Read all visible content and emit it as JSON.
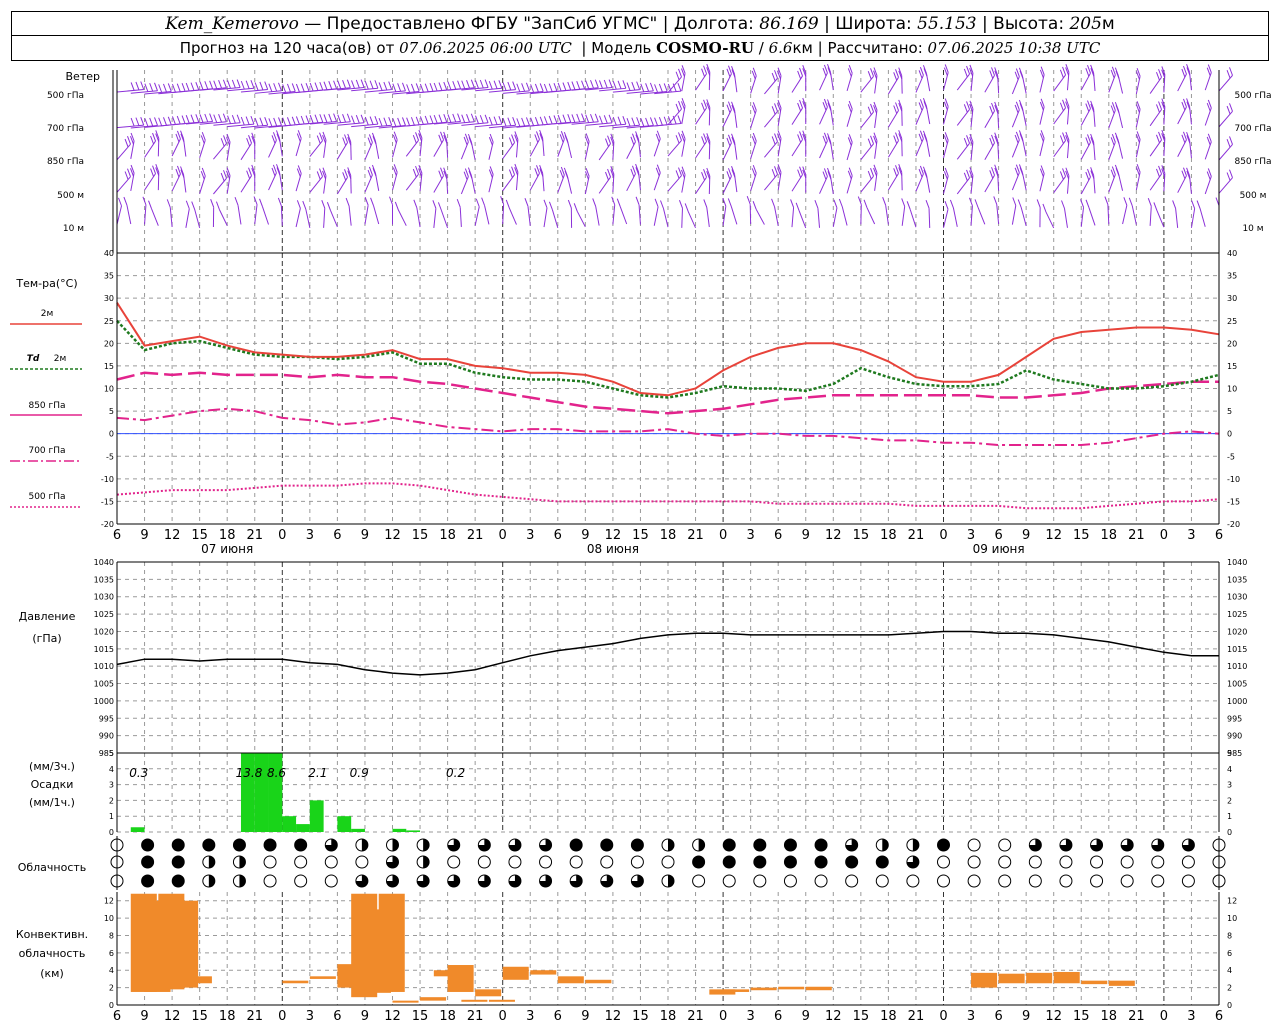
{
  "header": {
    "station": "Kem_Kemerovo",
    "provider": " — Предоставлено ФГБУ \"ЗапСиб УГМС\" | ",
    "lon_label": "Долгота: ",
    "lon_value": "86.169",
    "lat_label": " | Широта: ",
    "lat_value": "55.153",
    "alt_label": " | Высота: ",
    "alt_value": "205",
    "alt_unit": "м",
    "forecast_label": "Прогноз на 120 часа(ов) от ",
    "forecast_date": "07.06.2025 06:00 UTC",
    "model_label": "  | Модель ",
    "model_value": "COSMO-RU",
    "model_sep": " / ",
    "res_value": "6.6",
    "res_unit": "км",
    "calc_label": " | Рассчитано: ",
    "calc_date": "07.06.2025 10:38 UTC"
  },
  "colors": {
    "wind": "#8b30d8",
    "t2m": "#e8433a",
    "td2m": "#1f7a1f",
    "t850": "#e2238c",
    "t700": "#e2238c",
    "t500": "#e2238c",
    "zero": "#3050ff",
    "precip": "#19d419",
    "convective": "#f08a2a",
    "grid": "#9a9a9a"
  },
  "labels": {
    "wind": "Ветер",
    "wind_levels": [
      "500 гПа",
      "700 гПа",
      "850 гПа",
      "500 м",
      "10 м"
    ],
    "temp": "Тем-ра(°C)",
    "t2m": "2м",
    "td": "Td",
    "td_level": "2м",
    "t850": "850 гПа",
    "t700": "700 гПа",
    "t500": "500 гПа",
    "pressure": "Давление",
    "pressure_unit": "(гПа)",
    "precip_unit3": "(мм/3ч.)",
    "precip": "Осадки",
    "precip_unit1": "(мм/1ч.)",
    "cloud": "Облачность",
    "conv1": "Конвективн.",
    "conv2": "облачность",
    "conv3": "(км)"
  },
  "chart_data": {
    "type": "line",
    "x_hours": [
      0,
      3,
      6,
      9,
      12,
      15,
      18,
      21,
      24,
      27,
      30,
      33,
      36,
      39,
      42,
      45,
      48,
      51,
      54,
      57,
      60,
      63,
      66,
      69,
      72,
      75,
      78,
      81,
      84,
      87,
      90,
      93,
      96,
      99,
      102,
      105,
      108,
      111,
      114,
      117,
      120
    ],
    "x_tick_labels": [
      "6",
      "9",
      "12",
      "15",
      "18",
      "21",
      "0",
      "3",
      "6",
      "9",
      "12",
      "15",
      "18",
      "21",
      "0",
      "3",
      "6",
      "9",
      "12",
      "15",
      "18",
      "21",
      "0",
      "3",
      "6",
      "9",
      "12",
      "15",
      "18",
      "21",
      "0",
      "3",
      "6",
      "9",
      "12",
      "15",
      "18",
      "21",
      "0",
      "3",
      "6",
      "9",
      "12"
    ],
    "day_labels": [
      "07 июня",
      "08 июня",
      "09 июня"
    ],
    "temperature": {
      "ylim": [
        -20,
        40
      ],
      "ticks": [
        -20,
        -15,
        -10,
        -5,
        0,
        5,
        10,
        15,
        20,
        25,
        30,
        35,
        40
      ],
      "t2m": [
        29,
        19.5,
        20.5,
        21.5,
        19.5,
        18,
        17.5,
        17,
        17,
        17.5,
        18.5,
        16.5,
        16.5,
        15,
        14.5,
        13.5,
        13.5,
        13,
        11.5,
        9,
        8.5,
        10,
        14,
        17,
        19,
        20,
        20,
        18.5,
        16,
        12.5,
        11.5,
        11.5,
        13,
        17,
        21,
        22.5,
        23,
        23.5,
        23.5,
        23,
        22
      ],
      "td2m": [
        25,
        18.5,
        20,
        20.5,
        19,
        17.5,
        17,
        17,
        16.5,
        17,
        18,
        15.5,
        15.5,
        13.5,
        12.5,
        12,
        12,
        11.5,
        10,
        8.5,
        8,
        9,
        10.5,
        10,
        10,
        9.5,
        11,
        14.5,
        12.5,
        11,
        10.5,
        10.5,
        11,
        14,
        12,
        11,
        10,
        10,
        10.5,
        11.5,
        13
      ],
      "t850": [
        12,
        13.5,
        13,
        13.5,
        13,
        13,
        13,
        12.5,
        13,
        12.5,
        12.5,
        11.5,
        11,
        10,
        9,
        8,
        7,
        6,
        5.5,
        5,
        4.5,
        5,
        5.5,
        6.5,
        7.5,
        8,
        8.5,
        8.5,
        8.5,
        8.5,
        8.5,
        8.5,
        8,
        8,
        8.5,
        9,
        10,
        10.5,
        11,
        11.5,
        11.5
      ],
      "t700": [
        3.5,
        3,
        4,
        5,
        5.5,
        5,
        3.5,
        3,
        2,
        2.5,
        3.5,
        2.5,
        1.5,
        1,
        0.5,
        1,
        1,
        0.5,
        0.5,
        0.5,
        1,
        0,
        -0.5,
        0,
        0,
        -0.5,
        -0.5,
        -1,
        -1.5,
        -1.5,
        -2,
        -2,
        -2.5,
        -2.5,
        -2.5,
        -2.5,
        -2,
        -1,
        0,
        0.5,
        0
      ],
      "t500": [
        -13.5,
        -13,
        -12.5,
        -12.5,
        -12.5,
        -12,
        -11.5,
        -11.5,
        -11.5,
        -11,
        -11,
        -11.5,
        -12.5,
        -13.5,
        -14,
        -14.5,
        -15,
        -15,
        -15,
        -15,
        -15,
        -15,
        -15,
        -15,
        -15.5,
        -15.5,
        -15.5,
        -15.5,
        -15.5,
        -16,
        -16,
        -16,
        -16,
        -16.5,
        -16.5,
        -16.5,
        -16,
        -15.5,
        -15,
        -15,
        -14.5
      ]
    },
    "pressure": {
      "ylim": [
        985,
        1040
      ],
      "ticks": [
        985,
        990,
        995,
        1000,
        1005,
        1010,
        1015,
        1020,
        1025,
        1030,
        1035,
        1040
      ],
      "values": [
        1010.5,
        1012,
        1012,
        1011.5,
        1012,
        1012,
        1012,
        1011,
        1010.5,
        1009,
        1008,
        1007.5,
        1008,
        1009,
        1011,
        1013,
        1014.5,
        1015.5,
        1016.5,
        1018,
        1019,
        1019.5,
        1019.5,
        1019,
        1019,
        1019,
        1019,
        1019,
        1019,
        1019.5,
        1020,
        1020,
        1019.5,
        1019.5,
        1019,
        1018,
        1017,
        1015.5,
        1014,
        1013,
        1013
      ]
    },
    "precip": {
      "ylim": [
        0,
        5
      ],
      "ticks": [
        0,
        1,
        2,
        3,
        4,
        5
      ],
      "hourly": [
        [
          1,
          0.3
        ],
        [
          9,
          5
        ],
        [
          10,
          5
        ],
        [
          11,
          5
        ],
        [
          12,
          1
        ],
        [
          13,
          0.5
        ],
        [
          14,
          2
        ],
        [
          16,
          1
        ],
        [
          17,
          0.2
        ],
        [
          20,
          0.2
        ],
        [
          21,
          0.1
        ]
      ],
      "three_hour_labels": [
        {
          "h": 1,
          "text": "0.3"
        },
        {
          "h": 9,
          "text": "13.8"
        },
        {
          "h": 11,
          "text": "8.6"
        },
        {
          "h": 14,
          "text": "2.1"
        },
        {
          "h": 17,
          "text": "0.9"
        },
        {
          "h": 24,
          "text": "0.2"
        }
      ]
    },
    "cloud": {
      "rows": [
        "0444444321133334442144443224003333330",
        "0442100003100000000444444430000000000",
        "0442100033333333331000000000000000000"
      ]
    },
    "convective": {
      "ylim": [
        0,
        13
      ],
      "ticks": [
        0,
        2,
        4,
        6,
        8,
        10,
        12
      ],
      "bars": [
        [
          0.5,
          1.5,
          12.8
        ],
        [
          1,
          1.5,
          12
        ],
        [
          1.5,
          1.8,
          12.8
        ],
        [
          2,
          2,
          12
        ],
        [
          2.5,
          2.5,
          3.3
        ],
        [
          6,
          2.5,
          2.8
        ],
        [
          7,
          3,
          3.3
        ],
        [
          8,
          2,
          4.7
        ],
        [
          8.5,
          0.9,
          12.8
        ],
        [
          9,
          1.4,
          11
        ],
        [
          9.5,
          1.5,
          12.8
        ],
        [
          10,
          0.4,
          0.5
        ],
        [
          11,
          0.5,
          0.9
        ],
        [
          11.5,
          3.3,
          4
        ],
        [
          12,
          1.5,
          4.6
        ],
        [
          12.5,
          0.5,
          0.6
        ],
        [
          13,
          1,
          1.8
        ],
        [
          13.5,
          0.4,
          0.6
        ],
        [
          14,
          2.9,
          4.4
        ],
        [
          15,
          3.5,
          4
        ],
        [
          16,
          2.5,
          3.3
        ],
        [
          17,
          2.5,
          2.9
        ],
        [
          21.5,
          1.2,
          1.8
        ],
        [
          22,
          1.5,
          1.8
        ],
        [
          23,
          1.7,
          2
        ],
        [
          24,
          1.8,
          2.1
        ],
        [
          25,
          1.7,
          2.1
        ],
        [
          31,
          2,
          3.7
        ],
        [
          32,
          2.5,
          3.6
        ],
        [
          33,
          2.5,
          3.7
        ],
        [
          34,
          2.5,
          3.8
        ],
        [
          35,
          2.4,
          2.8
        ],
        [
          36,
          2.2,
          2.8
        ]
      ]
    }
  }
}
